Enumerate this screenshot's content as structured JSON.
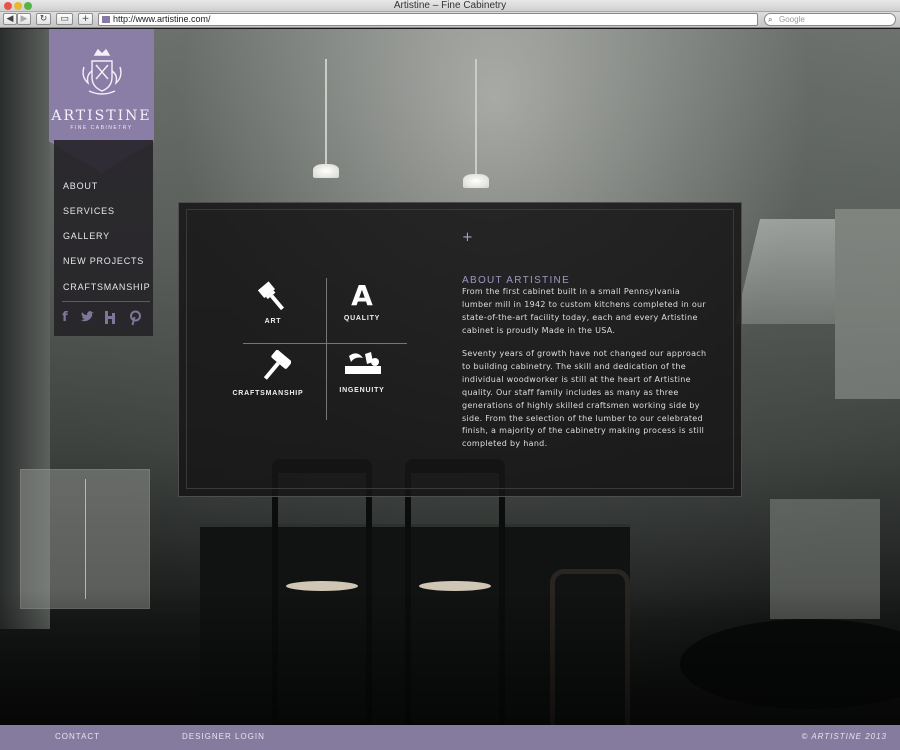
{
  "browser": {
    "title": "Artistine – Fine Cabinetry",
    "url": "http://www.artistine.com/",
    "search_placeholder": "Google"
  },
  "logo": {
    "name": "ARTISTINE",
    "tagline": "Fine Cabinetry"
  },
  "nav": {
    "items": [
      "ABOUT",
      "SERVICES",
      "GALLERY",
      "NEW PROJECTS",
      "CRAFTSMANSHIP"
    ],
    "social_icons": [
      "facebook-icon",
      "twitter-icon",
      "houzz-icon",
      "pinterest-icon"
    ]
  },
  "features": {
    "art": "ART",
    "quality": "QUALITY",
    "quality_glyph": "A",
    "craftsmanship": "CRAFTSMANSHIP",
    "ingenuity": "INGENUITY"
  },
  "about": {
    "heading": "ABOUT ARTISTINE",
    "p1": "From the first cabinet built in a small Pennsylvania lumber mill in 1942 to custom kitchens completed in our state-of-the-art facility today, each and every Artistine cabinet is proudly Made in the USA.",
    "p2": "Seventy years of growth have not changed our approach to building cabinetry. The skill and dedication of the individual woodworker is still at the heart of Artistine quality. Our staff family includes as many as three generations of highly skilled craftsmen working side by side. From the selection of the lumber to our celebrated finish, a majority of the cabinetry making process is still completed by hand."
  },
  "footer": {
    "contact": "CONTACT",
    "designer_login": "DESIGNER LOGIN",
    "copyright": "© ARTISTINE 2013"
  },
  "colors": {
    "brand_purple": "#8a7ea7",
    "footer_purple": "#847b9f",
    "heading_lavender": "#a195c3"
  }
}
